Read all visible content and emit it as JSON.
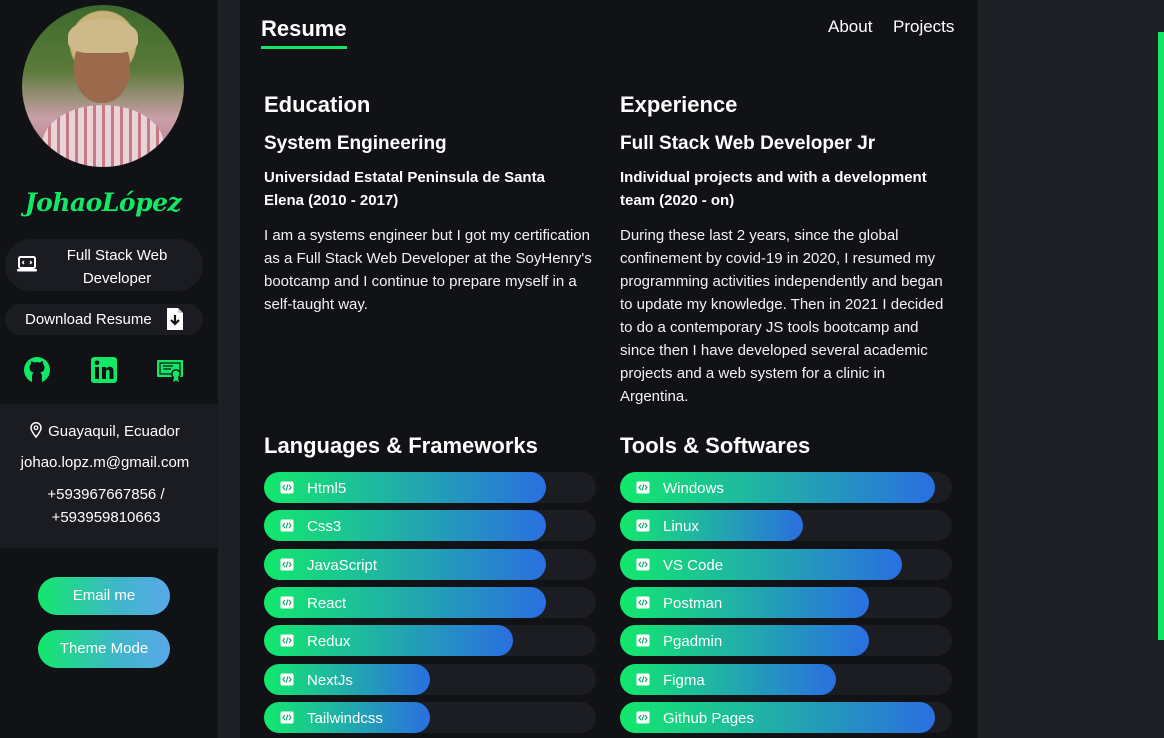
{
  "sidebar": {
    "signature": "JohaoLópez",
    "role": "Full Stack Web Developer",
    "download_label": "Download Resume",
    "social": [
      "github-icon",
      "linkedin-icon",
      "certificate-icon"
    ],
    "location": "Guayaquil, Ecuador",
    "email": "johao.lopz.m@gmail.com",
    "phone": "+593967667856 / +593959810663",
    "email_button": "Email me",
    "theme_button": "Theme Mode"
  },
  "header": {
    "brand": "Resume",
    "nav": [
      "About",
      "Projects"
    ]
  },
  "education": {
    "title": "Education",
    "degree": "System Engineering",
    "institution": "Universidad Estatal Peninsula de Santa Elena (2010 - 2017)",
    "description": "I am a systems engineer but I got my certification as a Full Stack Web Developer at the SoyHenry's bootcamp and I continue to prepare myself in a self-taught way."
  },
  "experience": {
    "title": "Experience",
    "position": "Full Stack Web Developer Jr",
    "context": "Individual projects and with a development team (2020 - on)",
    "description": "During these last 2 years, since the global confinement by covid-19 in 2020, I resumed my programming activities independently and began to update my knowledge. Then in 2021 I decided to do a contemporary JS tools bootcamp and since then I have developed several academic projects and a web system for a clinic in Argentina."
  },
  "languages": {
    "title": "Languages & Frameworks",
    "items": [
      {
        "label": "Html5",
        "level": 0.85
      },
      {
        "label": "Css3",
        "level": 0.85
      },
      {
        "label": "JavaScript",
        "level": 0.85
      },
      {
        "label": "React",
        "level": 0.85
      },
      {
        "label": "Redux",
        "level": 0.75
      },
      {
        "label": "NextJs",
        "level": 0.5
      },
      {
        "label": "Tailwindcss",
        "level": 0.5
      }
    ]
  },
  "tools": {
    "title": "Tools & Softwares",
    "items": [
      {
        "label": "Windows",
        "level": 0.95
      },
      {
        "label": "Linux",
        "level": 0.55
      },
      {
        "label": "VS Code",
        "level": 0.85
      },
      {
        "label": "Postman",
        "level": 0.75
      },
      {
        "label": "Pgadmin",
        "level": 0.75
      },
      {
        "label": "Figma",
        "level": 0.65
      },
      {
        "label": "Github Pages",
        "level": 0.95
      }
    ]
  },
  "colors": {
    "accent": "#12e865",
    "background": "#111216",
    "panel": "#1b1c21",
    "bar_end": "#2a6fe0"
  }
}
